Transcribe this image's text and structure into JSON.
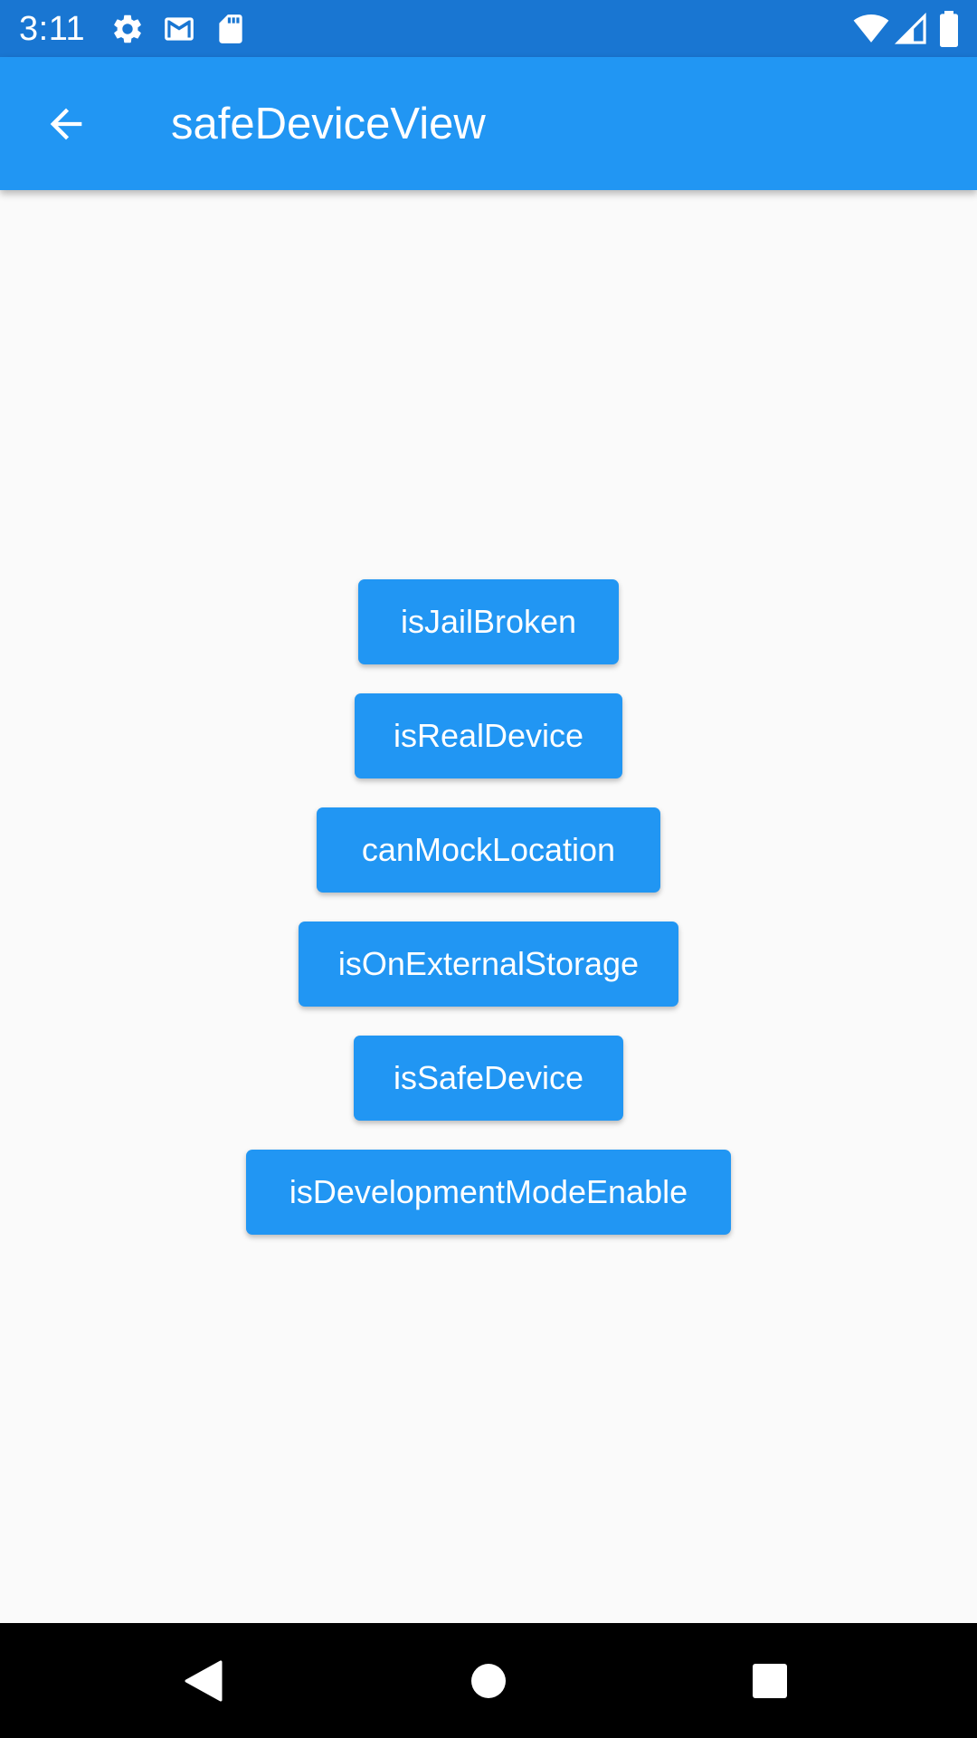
{
  "status_bar": {
    "time": "3:11",
    "icons": [
      "settings-icon",
      "gmail-icon",
      "sd-card-icon",
      "wifi-icon",
      "signal-icon",
      "battery-icon"
    ],
    "background_color": "#1976d2"
  },
  "app_bar": {
    "title": "safeDeviceView",
    "back_icon": "arrow-back-icon",
    "background_color": "#2196f3"
  },
  "buttons": [
    {
      "label": "isJailBroken"
    },
    {
      "label": "isRealDevice"
    },
    {
      "label": "canMockLocation"
    },
    {
      "label": "isOnExternalStorage"
    },
    {
      "label": "isSafeDevice"
    },
    {
      "label": "isDevelopmentModeEnable"
    }
  ],
  "button_color": "#2196f3",
  "nav_bar": {
    "icons": [
      "back-triangle-icon",
      "home-circle-icon",
      "recents-square-icon"
    ]
  }
}
